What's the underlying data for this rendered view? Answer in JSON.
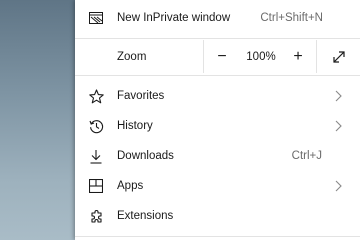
{
  "menu": {
    "new_inprivate": {
      "label": "New InPrivate window",
      "shortcut": "Ctrl+Shift+N",
      "icon": "inprivate-window-icon"
    },
    "zoom": {
      "label": "Zoom",
      "decrease": "−",
      "value": "100%",
      "increase": "+",
      "fullscreen_icon": "fullscreen-icon"
    },
    "items": [
      {
        "label": "Favorites",
        "icon": "star-icon",
        "shortcut": "",
        "has_submenu": true
      },
      {
        "label": "History",
        "icon": "history-icon",
        "shortcut": "",
        "has_submenu": true
      },
      {
        "label": "Downloads",
        "icon": "download-icon",
        "shortcut": "Ctrl+J",
        "has_submenu": false
      },
      {
        "label": "Apps",
        "icon": "apps-icon",
        "shortcut": "",
        "has_submenu": true
      },
      {
        "label": "Extensions",
        "icon": "extensions-icon",
        "shortcut": "",
        "has_submenu": false
      }
    ]
  },
  "colors": {
    "menu_background": "#ffffff",
    "text": "#1a1a1a",
    "shortcut_text": "#6b6b6b",
    "divider": "#e3e3e3"
  }
}
